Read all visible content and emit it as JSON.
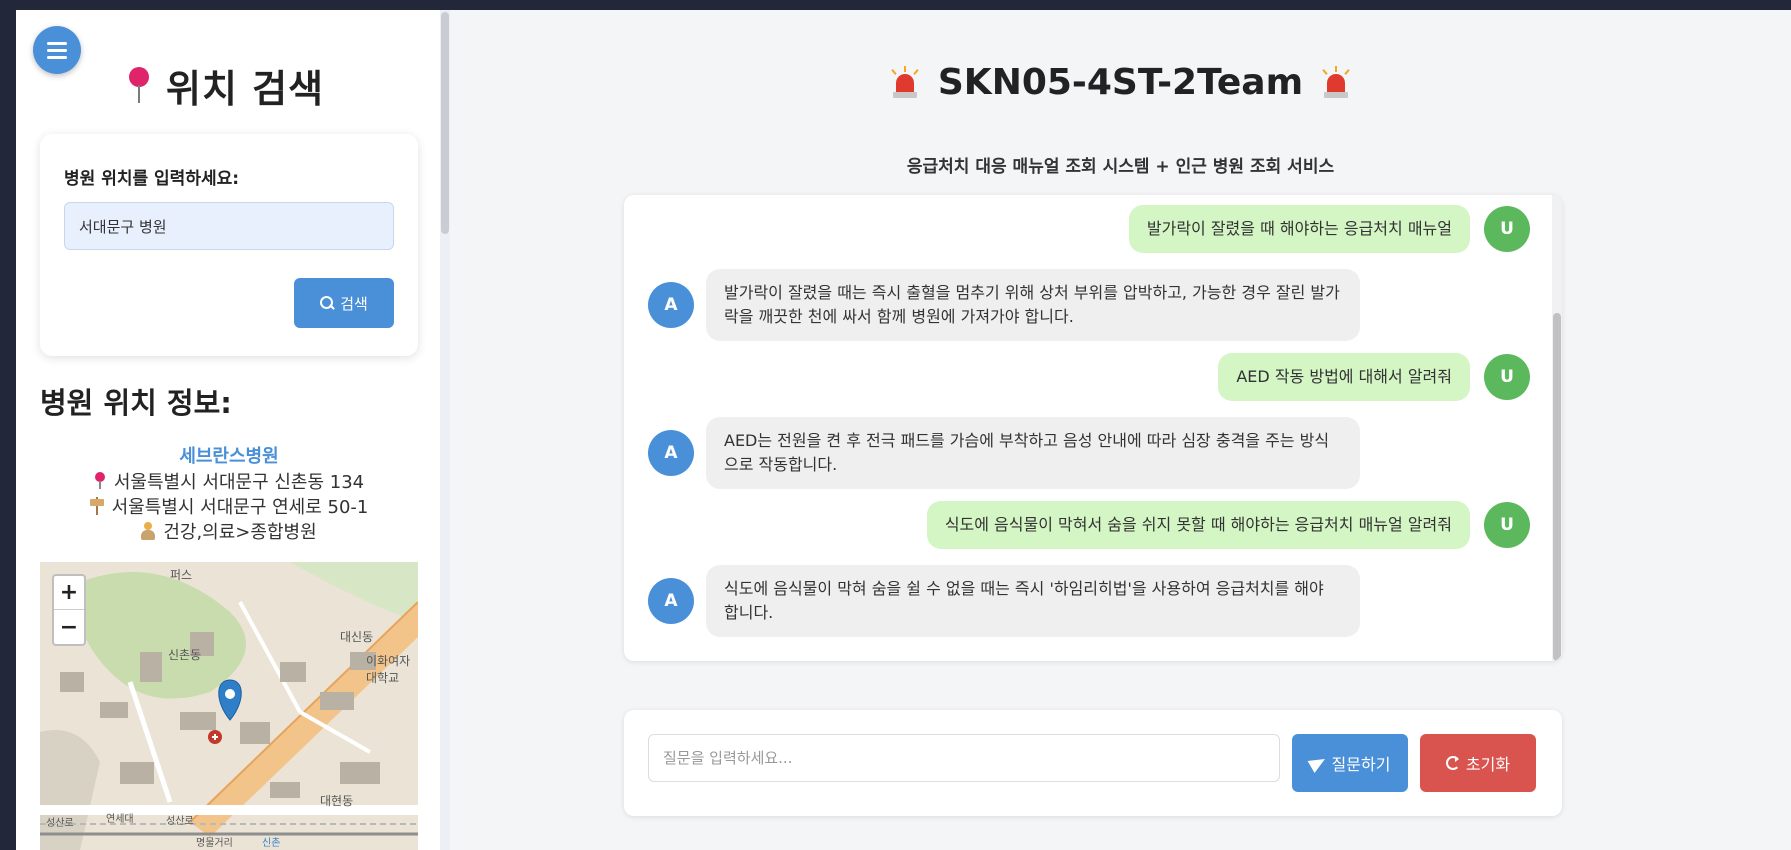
{
  "sidebar": {
    "title": "위치 검색",
    "search_label": "병원 위치를 입력하세요:",
    "search_value": "서대문구 병원",
    "search_button": "검색",
    "info_title": "병원 위치 정보:",
    "hospital": {
      "name": "세브란스병원",
      "address": "서울특별시 서대문구 신촌동 134",
      "road_address": "서울특별시 서대문구 연세로 50-1",
      "category": "건강,의료>종합병원"
    },
    "map": {
      "zoom_in": "+",
      "zoom_out": "−",
      "labels": [
        "퍼스",
        "신촌동",
        "대신동",
        "이화여자대학교",
        "대현동",
        "성산로",
        "연세대",
        "성산로",
        "명물거리",
        "신촌"
      ]
    }
  },
  "main": {
    "title": "SKN05-4ST-2Team",
    "subtitle": "응급처치 대응 매뉴얼 조회 시스템 + 인근 병원 조회 서비스",
    "messages": [
      {
        "role": "user",
        "avatar": "U",
        "text": "발가락이 잘렸을 때 해야하는 응급처치 매뉴얼"
      },
      {
        "role": "bot",
        "avatar": "A",
        "text": "발가락이 잘렸을 때는 즉시 출혈을 멈추기 위해 상처 부위를 압박하고, 가능한 경우 잘린 발가락을 깨끗한 천에 싸서 함께 병원에 가져가야 합니다."
      },
      {
        "role": "user",
        "avatar": "U",
        "text": "AED 작동 방법에 대해서 알려줘"
      },
      {
        "role": "bot",
        "avatar": "A",
        "text": "AED는 전원을 켠 후 전극 패드를 가슴에 부착하고 음성 안내에 따라 심장 충격을 주는 방식으로 작동합니다."
      },
      {
        "role": "user",
        "avatar": "U",
        "text": "식도에 음식물이 막혀서 숨을 쉬지 못할 때 해야하는 응급처치 매뉴얼 알려줘"
      },
      {
        "role": "bot",
        "avatar": "A",
        "text": "식도에 음식물이 막혀 숨을 쉴 수 없을 때는 즉시 '하임리히법'을 사용하여 응급처치를 해야 합니다."
      }
    ],
    "input_placeholder": "질문을 입력하세요...",
    "ask_button": "질문하기",
    "reset_button": "초기화"
  },
  "colors": {
    "accent": "#4a90d9",
    "user_avatar": "#5cb85c",
    "user_bubble": "#d4f5c4",
    "bot_bubble": "#efefef",
    "reset": "#d9534f",
    "pin": "#e0246b",
    "background": "#22273a"
  },
  "icons": [
    "menu-icon",
    "pin-icon",
    "search-icon",
    "sign-icon",
    "person-icon",
    "siren-icon",
    "send-icon",
    "refresh-icon",
    "map-marker-icon"
  ]
}
